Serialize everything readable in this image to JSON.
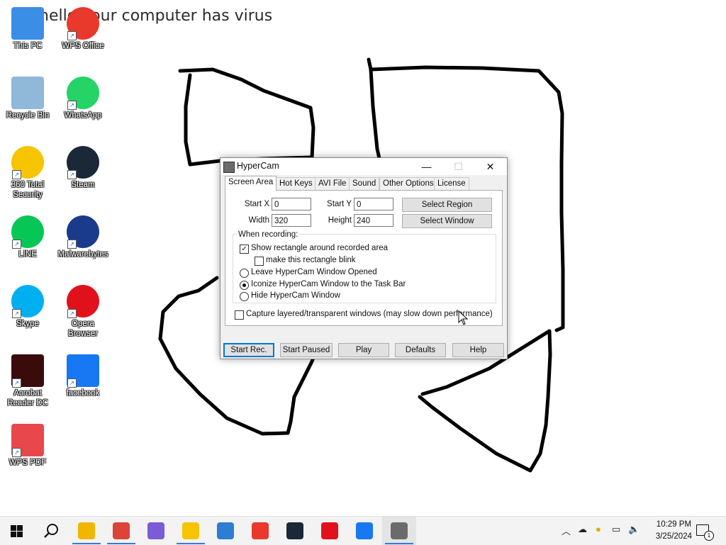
{
  "desktop": {
    "banner_text": "hello your computer has virus",
    "icons": [
      {
        "label": "This PC",
        "icon": "this-pc-icon",
        "color": "#3a8ee6",
        "shortcut": false
      },
      {
        "label": "WPS Office",
        "icon": "wps-office-icon",
        "color": "#e8392c",
        "shortcut": true
      },
      {
        "label": "Recycle Bin",
        "icon": "recycle-bin-icon",
        "color": "#8fb8d9",
        "shortcut": false
      },
      {
        "label": "WhatsApp",
        "icon": "whatsapp-icon",
        "color": "#25d366",
        "shortcut": true
      },
      {
        "label": "360 Total Security",
        "icon": "360-security-icon",
        "color": "#f6c400",
        "shortcut": true
      },
      {
        "label": "Steam",
        "icon": "steam-icon",
        "color": "#1b2838",
        "shortcut": true
      },
      {
        "label": "LINE",
        "icon": "line-icon",
        "color": "#06c755",
        "shortcut": true
      },
      {
        "label": "Malwarebytes",
        "icon": "malwarebytes-icon",
        "color": "#1a3a8c",
        "shortcut": true
      },
      {
        "label": "Skype",
        "icon": "skype-icon",
        "color": "#00aff0",
        "shortcut": true
      },
      {
        "label": "Opera Browser",
        "icon": "opera-icon",
        "color": "#e0111b",
        "shortcut": true
      },
      {
        "label": "Acrobat Reader DC",
        "icon": "acrobat-icon",
        "color": "#3a0b0b",
        "shortcut": true
      },
      {
        "label": "facebook",
        "icon": "facebook-icon",
        "color": "#1877f2",
        "shortcut": true
      },
      {
        "label": "WPS PDF",
        "icon": "wps-pdf-icon",
        "color": "#e8484b",
        "shortcut": true
      }
    ]
  },
  "window": {
    "title": "HyperCam",
    "minimize": "—",
    "maximize": "☐",
    "close": "✕",
    "tabs": [
      "Screen Area",
      "Hot Keys",
      "AVI File",
      "Sound",
      "Other Options",
      "License"
    ],
    "active_tab": "Screen Area",
    "fields": {
      "start_x_label": "Start X",
      "start_x": "0",
      "start_y_label": "Start Y",
      "start_y": "0",
      "width_label": "Width",
      "width": "320",
      "height_label": "Height",
      "height": "240"
    },
    "select_region": "Select Region",
    "select_window": "Select Window",
    "group_title": "When recording:",
    "options": {
      "show_rect": {
        "label": "Show rectangle around recorded area",
        "checked": true
      },
      "blink": {
        "label": "make this rectangle blink",
        "checked": false
      },
      "leave_open": {
        "label": "Leave HyperCam Window Opened",
        "selected": false
      },
      "iconize": {
        "label": "Iconize HyperCam Window to the Task Bar",
        "selected": true
      },
      "hide": {
        "label": "Hide HyperCam Window",
        "selected": false
      },
      "capture_layered": {
        "label": "Capture layered/transparent windows (may slow down performance)",
        "checked": false
      }
    },
    "buttons": [
      "Start Rec.",
      "Start Paused",
      "Play",
      "Defaults",
      "Help"
    ]
  },
  "taskbar": {
    "apps": [
      {
        "icon": "file-explorer-icon",
        "color": "#f2b600",
        "active": true
      },
      {
        "icon": "chrome-icon",
        "color": "#db4437",
        "active": true
      },
      {
        "icon": "copilot-icon",
        "color": "#7b5cd6",
        "active": false
      },
      {
        "icon": "360-security-icon",
        "color": "#f6c400",
        "active": true
      },
      {
        "icon": "downloader-icon",
        "color": "#2d7dd2",
        "active": false
      },
      {
        "icon": "wps-office-icon",
        "color": "#e8392c",
        "active": false
      },
      {
        "icon": "steam-icon",
        "color": "#1b2838",
        "active": false
      },
      {
        "icon": "opera-icon",
        "color": "#e0111b",
        "active": false
      },
      {
        "icon": "facebook-icon",
        "color": "#1877f2",
        "active": false
      },
      {
        "icon": "hypercam-icon",
        "color": "#6b6b6b",
        "active": true
      }
    ],
    "time": "10:29 PM",
    "date": "3/25/2024",
    "notification_count": "1"
  }
}
